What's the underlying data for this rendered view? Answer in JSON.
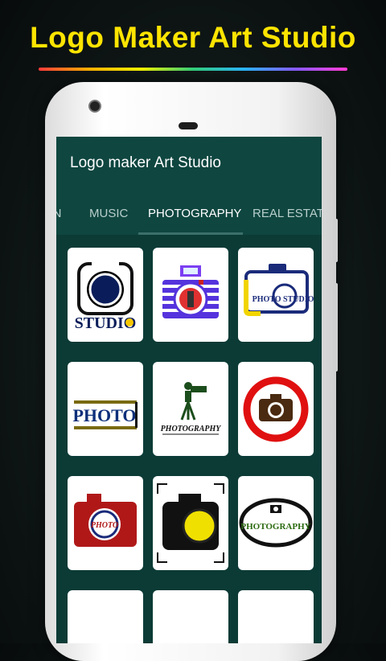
{
  "headline": "Logo Maker Art Studio",
  "app": {
    "title": "Logo maker Art Studio"
  },
  "tabs": [
    {
      "label": "ON",
      "active": false
    },
    {
      "label": "MUSIC",
      "active": false
    },
    {
      "label": "PHOTOGRAPHY",
      "active": true
    },
    {
      "label": "REAL ESTATI",
      "active": false
    }
  ],
  "logos": {
    "studio": "STUDIO",
    "photo_studio": "PHOTO STUDIO",
    "photo": "PHOTO",
    "photography_script": "PHOTOGRAPHY",
    "photo_small": "PHOTO",
    "photography": "PHOTOGRAPHY"
  },
  "colors": {
    "accent": "#fde400",
    "appbar": "#0f4640",
    "screen": "#0c3b36"
  }
}
